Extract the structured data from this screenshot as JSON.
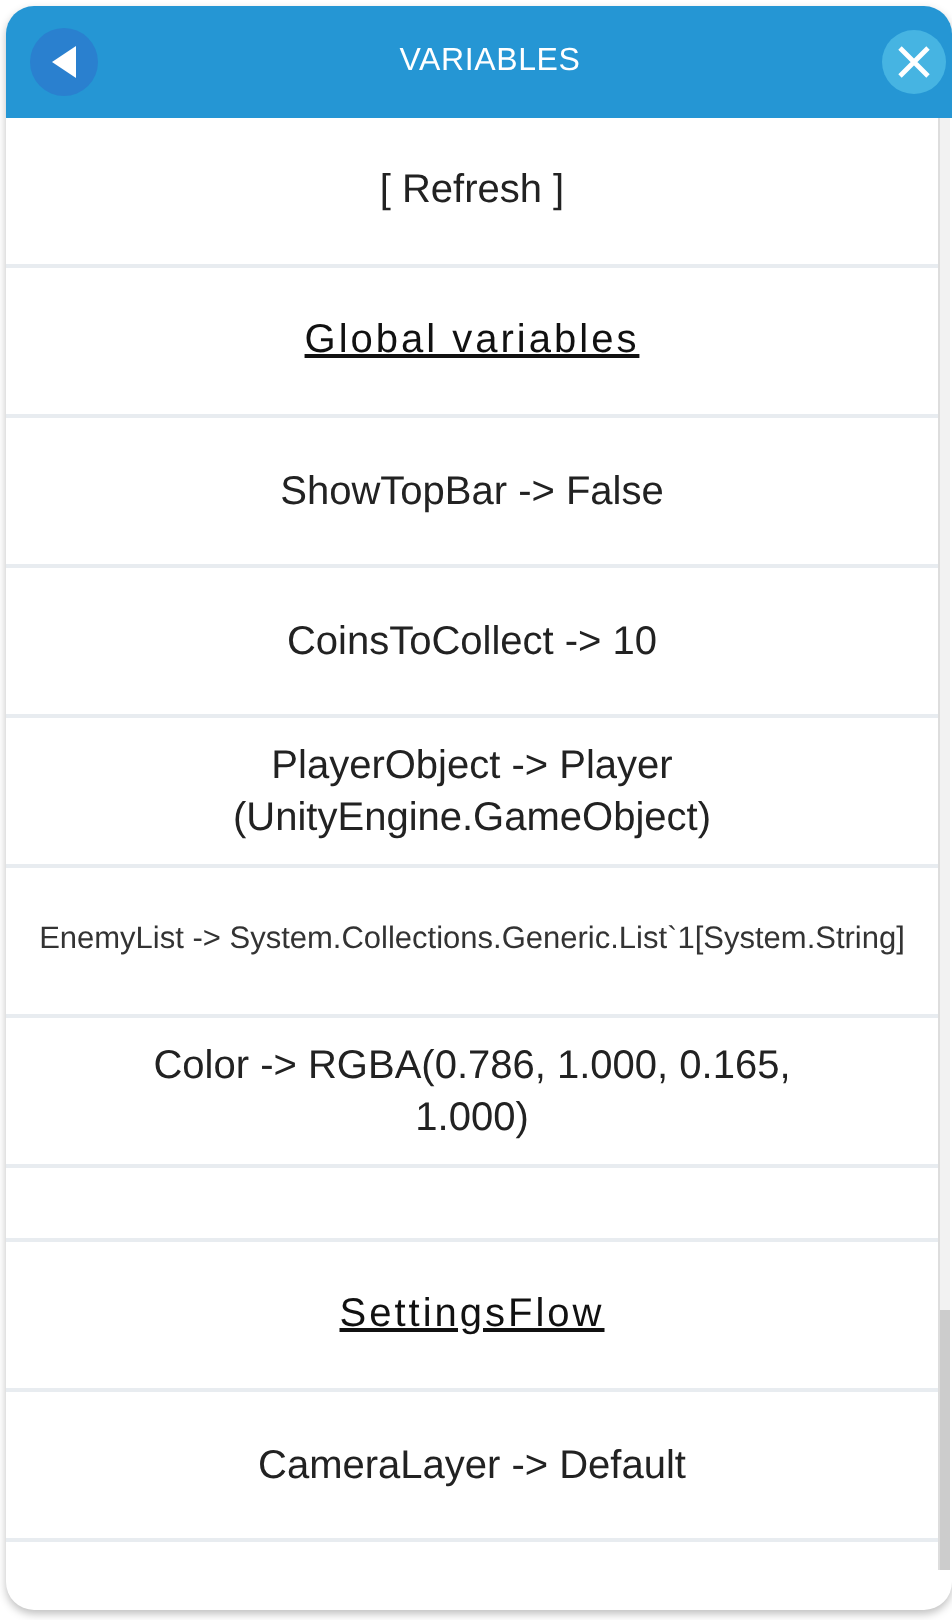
{
  "window": {
    "title": "VARIABLES"
  },
  "rows": [
    {
      "kind": "button",
      "text": "[ Refresh ]"
    },
    {
      "kind": "heading",
      "text": "Global variables"
    },
    {
      "kind": "value",
      "text": "ShowTopBar -> False"
    },
    {
      "kind": "value",
      "text": "CoinsToCollect -> 10"
    },
    {
      "kind": "value",
      "text": "PlayerObject -> Player (UnityEngine.GameObject)"
    },
    {
      "kind": "long-value",
      "text": "EnemyList -> System.Collections.Generic.List`1[System.String]"
    },
    {
      "kind": "value",
      "text": "Color -> RGBA(0.786, 1.000, 0.165, 1.000)"
    },
    {
      "kind": "spacer"
    },
    {
      "kind": "heading",
      "text": "SettingsFlow"
    },
    {
      "kind": "value",
      "text": "CameraLayer -> Default"
    }
  ]
}
